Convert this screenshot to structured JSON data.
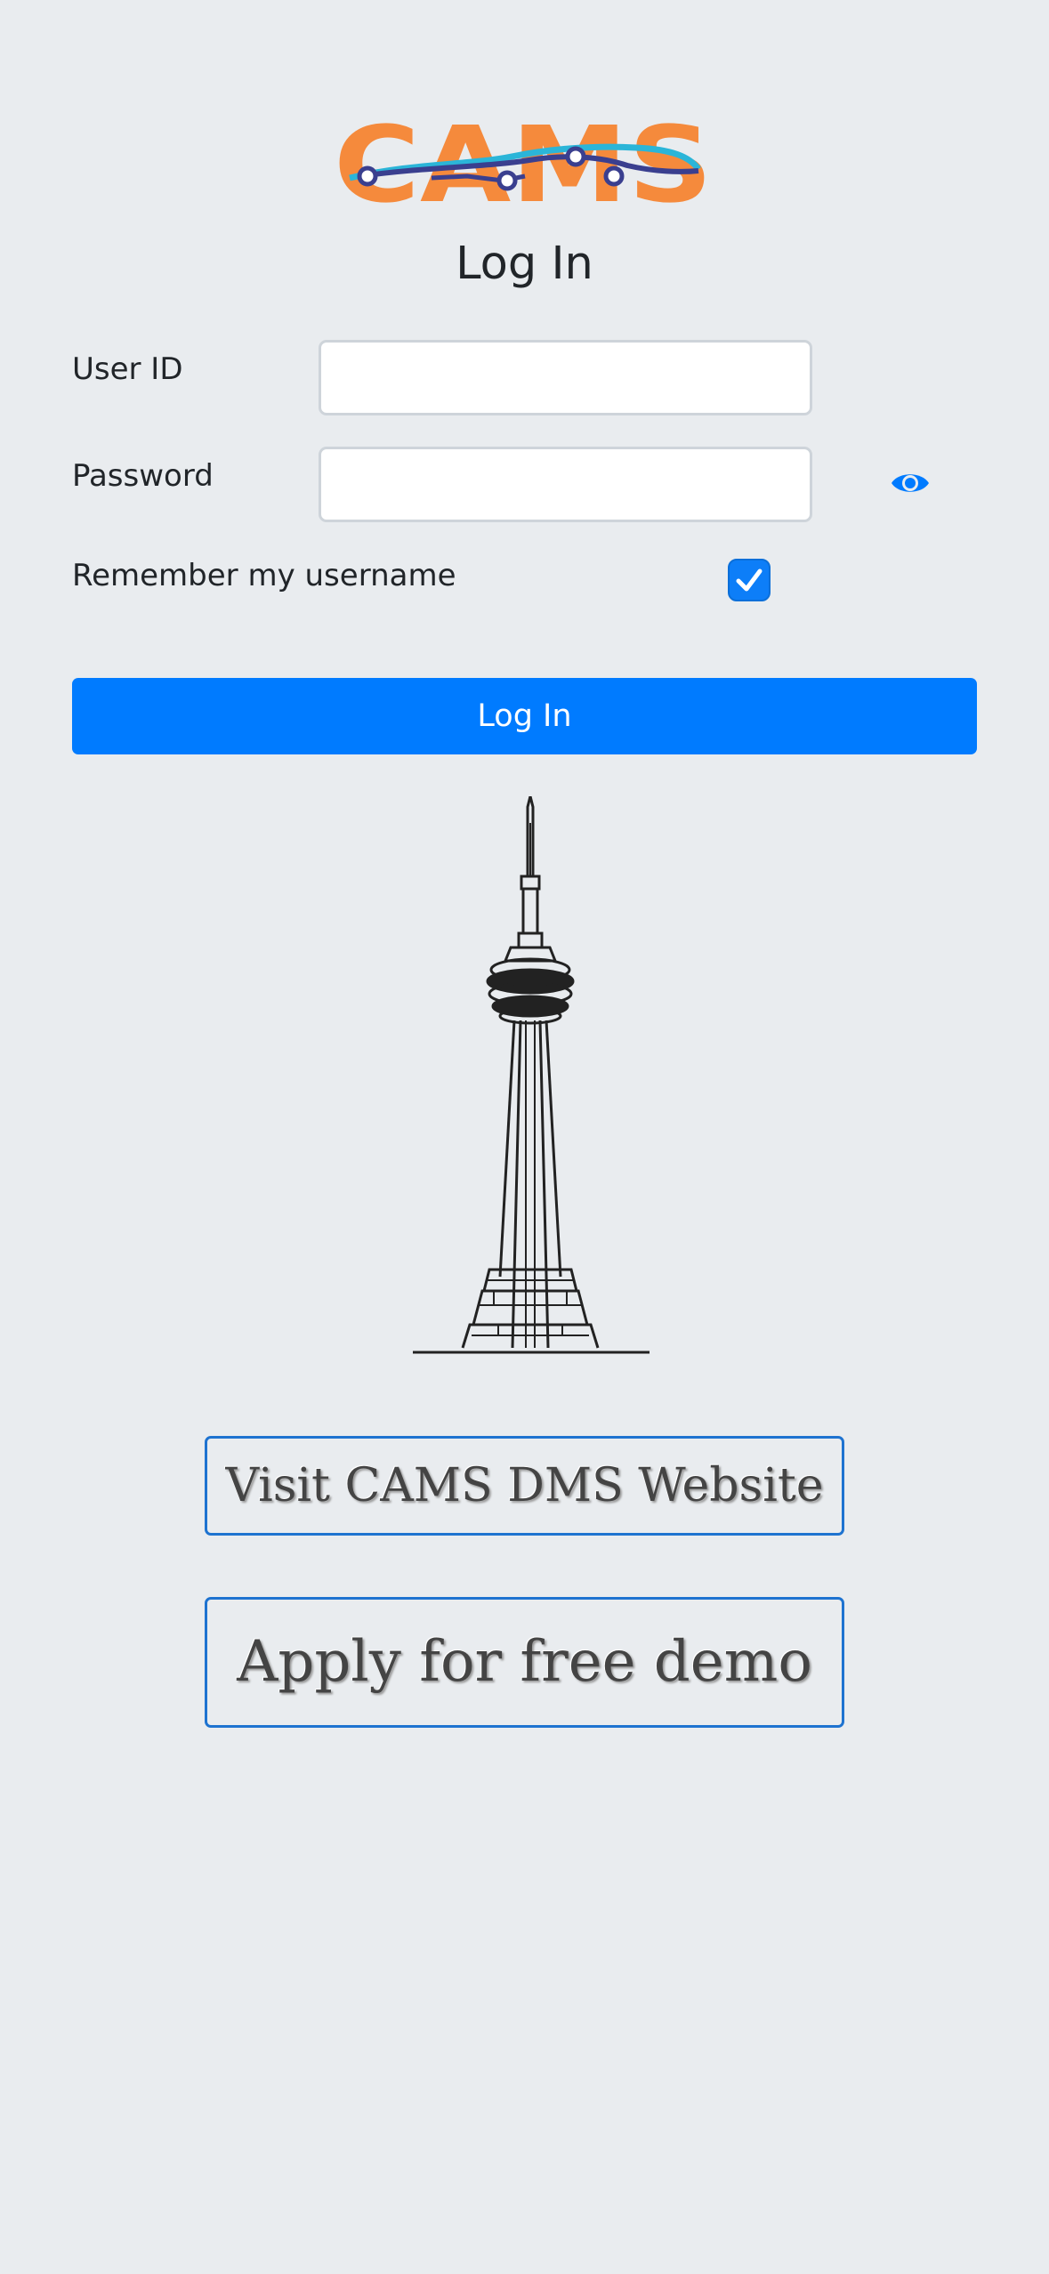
{
  "logo": {
    "text": "CAMS",
    "primary_color": "#f58a3c",
    "accent_color": "#3a3f8f",
    "highlight_color": "#2bb5d8"
  },
  "page_title": "Log In",
  "form": {
    "user_id_label": "User ID",
    "user_id_value": "",
    "password_label": "Password",
    "password_value": "",
    "show_password_icon": "eye-icon",
    "remember_label": "Remember my username",
    "remember_checked": true
  },
  "login_button_label": "Log In",
  "illustration": {
    "icon": "cn-tower-illustration"
  },
  "links": {
    "visit_label": "Visit CAMS DMS Website",
    "demo_label": "Apply for free demo"
  },
  "colors": {
    "background": "#e9ecef",
    "primary": "#007bff",
    "link_border": "#1e73d0"
  }
}
